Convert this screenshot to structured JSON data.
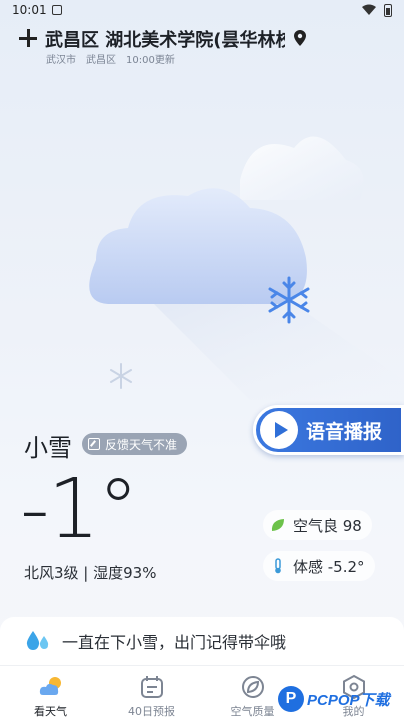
{
  "status_bar": {
    "time": "10:01"
  },
  "header": {
    "location_title": "武昌区 湖北美术学院(昙华林校",
    "city": "武汉市",
    "district": "武昌区",
    "updated": "10:00更新"
  },
  "weather": {
    "condition": "小雪",
    "feedback_label": "反馈天气不准",
    "temperature": "-1°",
    "wind_humidity": "北风3级 | 湿度93%",
    "air_quality": "空气良 98",
    "feels_like": "体感 -5.2°"
  },
  "voice_button": {
    "label": "语音播报"
  },
  "tip": {
    "text": "一直在下小雪，出门记得带伞哦"
  },
  "nav": {
    "items": [
      {
        "label": "看天气",
        "icon": "weather-cloud-sun-icon"
      },
      {
        "label": "40日预报",
        "icon": "calendar-icon"
      },
      {
        "label": "空气质量",
        "icon": "leaf-circle-icon"
      },
      {
        "label": "我的",
        "icon": "profile-hex-icon"
      }
    ]
  },
  "watermark": {
    "logo_letter": "P",
    "text": "PCPOP下载"
  },
  "colors": {
    "accent": "#2f6fd8",
    "badge": "#9aa4b4",
    "leaf": "#6cc24a"
  }
}
